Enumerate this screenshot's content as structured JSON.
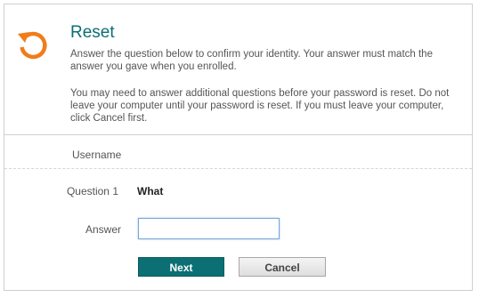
{
  "header": {
    "title": "Reset",
    "description_1": "Answer the question below to confirm your identity. Your answer must match the answer you gave when you enrolled.",
    "description_2": "You may need to answer additional questions before your password is reset. Do not leave your computer until your password is reset. If you must leave your computer, click Cancel first.",
    "icon": "reset-arrow-icon",
    "icon_color": "#f07d1a"
  },
  "form": {
    "username_label": "Username",
    "question_label": "Question 1",
    "question_text": "What",
    "answer_label": "Answer",
    "answer_value": ""
  },
  "buttons": {
    "next_label": "Next",
    "cancel_label": "Cancel"
  },
  "colors": {
    "accent": "#0c6f73",
    "text": "#555555"
  }
}
